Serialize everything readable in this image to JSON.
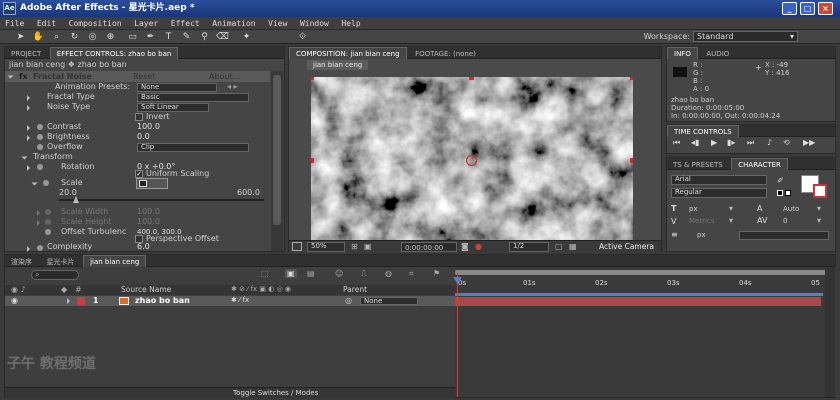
{
  "window": {
    "title": "Adobe After Effects - 星光卡片.aep *",
    "min": "_",
    "max": "□",
    "close": "×"
  },
  "menu": [
    "File",
    "Edit",
    "Composition",
    "Layer",
    "Effect",
    "Animation",
    "View",
    "Window",
    "Help"
  ],
  "workspace": {
    "label": "Workspace:",
    "value": "Standard"
  },
  "left_panel": {
    "tabs": [
      "PROJECT",
      "EFFECT CONTROLS: zhao bo ban"
    ],
    "breadcrumb": "jian bian ceng ❖ zhao bo ban",
    "effect": {
      "name": "Fractal Noise",
      "reset": "Reset",
      "about": "About..."
    },
    "props": {
      "animation_presets": {
        "label": "Animation Presets:",
        "value": "None"
      },
      "fractal_type": {
        "label": "Fractal Type",
        "value": "Basic"
      },
      "noise_type": {
        "label": "Noise Type",
        "value": "Soft Linear"
      },
      "invert": {
        "label": "Invert"
      },
      "contrast": {
        "label": "Contrast",
        "value": "100.0"
      },
      "brightness": {
        "label": "Brightness",
        "value": "0.0"
      },
      "overflow": {
        "label": "Overflow",
        "value": "Clip"
      },
      "transform": {
        "label": "Transform"
      },
      "rotation": {
        "label": "Rotation",
        "value": "0 x +0.0°"
      },
      "uniform_scaling": {
        "label": "Uniform Scaling"
      },
      "scale": {
        "label": "Scale",
        "value": "20.0",
        "min": "20.0",
        "max": "600.0"
      },
      "scale_width": {
        "label": "Scale Width",
        "value": "100.0"
      },
      "scale_height": {
        "label": "Scale Height",
        "value": "100.0"
      },
      "offset_turbulence": {
        "label": "Offset Turbulenc",
        "value": "400.0, 300.0"
      },
      "perspective_offset": {
        "label": "Perspective Offset"
      },
      "complexity": {
        "label": "Complexity",
        "value": "6.0"
      }
    }
  },
  "comp_panel": {
    "tabs": [
      "COMPOSITION: jian bian ceng",
      "FOOTAGE: (none)"
    ],
    "sub_tab": "jian bian ceng",
    "zoom": "50%",
    "timecode": "0:00:00:00",
    "resolution": "1/2",
    "view": "Active Camera"
  },
  "info_panel": {
    "tabs": [
      "INFO",
      "AUDIO"
    ],
    "R": "R :",
    "G": "G :",
    "B": "B :",
    "A": "A : 0",
    "X": "X : -49",
    "Y": "Y : 416",
    "layer": "zhao bo ban",
    "duration": "Duration: 0:00:05:00",
    "inout": "In: 0:00:00:00, Out: 0:00:04:24"
  },
  "time_controls": {
    "tab": "TIME CONTROLS"
  },
  "character_panel": {
    "tabs": [
      "TS & PRESETS",
      "CHARACTER"
    ],
    "font": "Arial",
    "style": "Regular",
    "size": "px",
    "leading": "Auto",
    "metrics": "Metrics",
    "tracking": "0",
    "stroke": "px"
  },
  "timeline": {
    "tabs": [
      "渲染序",
      "星光卡片",
      "jian bian ceng"
    ],
    "search_placeholder": "",
    "columns": {
      "source_name": "Source Name",
      "parent": "Parent"
    },
    "layer": {
      "index": "1",
      "name": "zhao bo ban",
      "parent": "None"
    },
    "ruler": [
      "0s",
      "01s",
      "02s",
      "03s",
      "04s",
      "05"
    ],
    "toggle": "Toggle Switches / Modes"
  },
  "watermark": {
    "text": "子午 教程频道"
  },
  "colors": {
    "accent_red": "#c84040",
    "layer_bar": "#a84a4a",
    "label_orange": "#d07030",
    "title_blue": "#2a4f9c"
  }
}
